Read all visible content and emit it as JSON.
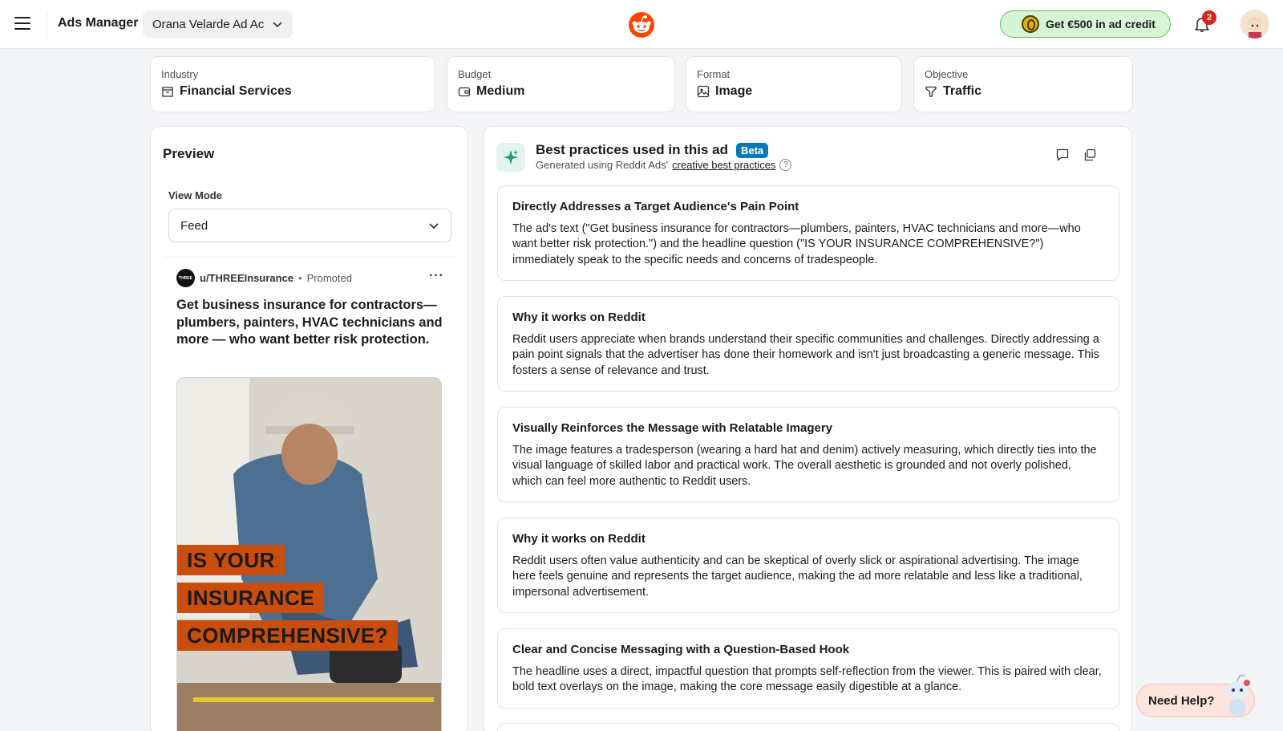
{
  "header": {
    "menu_icon": "hamburger-icon",
    "app_title": "Ads Manager",
    "account_name": "Orana Velarde Ad Ac",
    "logo_icon": "reddit-logo-icon",
    "credit_label": "Get €500 in ad credit",
    "notification_count": "2"
  },
  "filters": [
    {
      "label": "Industry",
      "value": "Financial Services",
      "icon": "building-icon"
    },
    {
      "label": "Budget",
      "value": "Medium",
      "icon": "wallet-icon"
    },
    {
      "label": "Format",
      "value": "Image",
      "icon": "image-icon"
    },
    {
      "label": "Objective",
      "value": "Traffic",
      "icon": "funnel-icon"
    }
  ],
  "preview": {
    "title": "Preview",
    "view_mode_label": "View Mode",
    "view_mode_value": "Feed",
    "post": {
      "avatar_text": "THREE",
      "username": "u/THREEInsurance",
      "separator": "•",
      "promoted": "Promoted",
      "more": "···",
      "text": "Get business insurance for contractors—plumbers, painters, HVAC technicians and more — who want better risk protection.",
      "image_lines": [
        "IS YOUR",
        "INSURANCE",
        "COMPREHENSIVE?"
      ]
    }
  },
  "best_practices": {
    "title": "Best practices used in this ad",
    "beta": "Beta",
    "subtitle_prefix": "Generated using Reddit Ads'",
    "subtitle_link": "creative best practices",
    "help": "?",
    "cards": [
      {
        "title": "Directly Addresses a Target Audience's Pain Point",
        "body": "The ad's text (\"Get business insurance for contractors—plumbers, painters, HVAC technicians and more—who want better risk protection.\") and the headline question (\"IS YOUR INSURANCE COMPREHENSIVE?\") immediately speak to the specific needs and concerns of tradespeople."
      },
      {
        "title": "Why it works on Reddit",
        "body": "Reddit users appreciate when brands understand their specific communities and challenges. Directly addressing a pain point signals that the advertiser has done their homework and isn't just broadcasting a generic message. This fosters a sense of relevance and trust."
      },
      {
        "title": "Visually Reinforces the Message with Relatable Imagery",
        "body": "The image features a tradesperson (wearing a hard hat and denim) actively measuring, which directly ties into the visual language of skilled labor and practical work. The overall aesthetic is grounded and not overly polished, which can feel more authentic to Reddit users."
      },
      {
        "title": "Why it works on Reddit",
        "body": "Reddit users often value authenticity and can be skeptical of overly slick or aspirational advertising. The image here feels genuine and represents the target audience, making the ad more relatable and less like a traditional, impersonal advertisement."
      },
      {
        "title": "Clear and Concise Messaging with a Question-Based Hook",
        "body": "The headline uses a direct, impactful question that prompts self-reflection from the viewer. This is paired with clear, bold text overlays on the image, making the core message easily digestible at a glance."
      }
    ]
  },
  "help": {
    "label": "Need Help?"
  },
  "colors": {
    "accent": "#ff4500",
    "credit_bg": "#d6f5d6",
    "beta": "#0a78b5",
    "ad_overlay": "#c94d0c"
  }
}
